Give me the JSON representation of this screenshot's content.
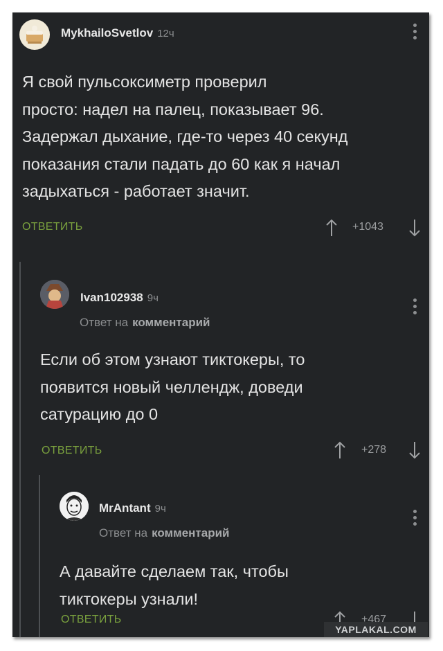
{
  "comments": [
    {
      "username": "MykhailoSvetlov",
      "time": "12ч",
      "text": "Я свой пульсоксиметр проверил\nпросто: надел на палец, показывает 96.\nЗадержал дыхание, где-то через 40 секунд\nпоказания стали падать до 60 как я начал\nзадыхаться - работает значит.",
      "reply_label": "ОТВЕТИТЬ",
      "votes": "+1043",
      "avatar_icon": "cake-avatar-icon"
    },
    {
      "username": "Ivan102938",
      "time": "9ч",
      "reply_to_prefix": "Ответ на",
      "reply_to_target": "комментарий",
      "text": "Если об этом узнают тиктокеры, то\nпоявится новый челлендж, доведи\nсатурацию до 0",
      "reply_label": "ОТВЕТИТЬ",
      "votes": "+278",
      "avatar_icon": "character-avatar-icon"
    },
    {
      "username": "MrAntant",
      "time": "9ч",
      "reply_to_prefix": "Ответ на",
      "reply_to_target": "комментарий",
      "text": "А давайте сделаем так, чтобы\nтиктокеры узнали!",
      "reply_label": "ОТВЕТИТЬ",
      "votes": "+467",
      "avatar_icon": "face-sketch-avatar-icon"
    }
  ],
  "watermark": "YAPLAKAL.COM",
  "colors": {
    "background": "#222426",
    "accent_green": "#7aa13e",
    "text": "#e4e4e4",
    "muted": "#8d8f91"
  }
}
